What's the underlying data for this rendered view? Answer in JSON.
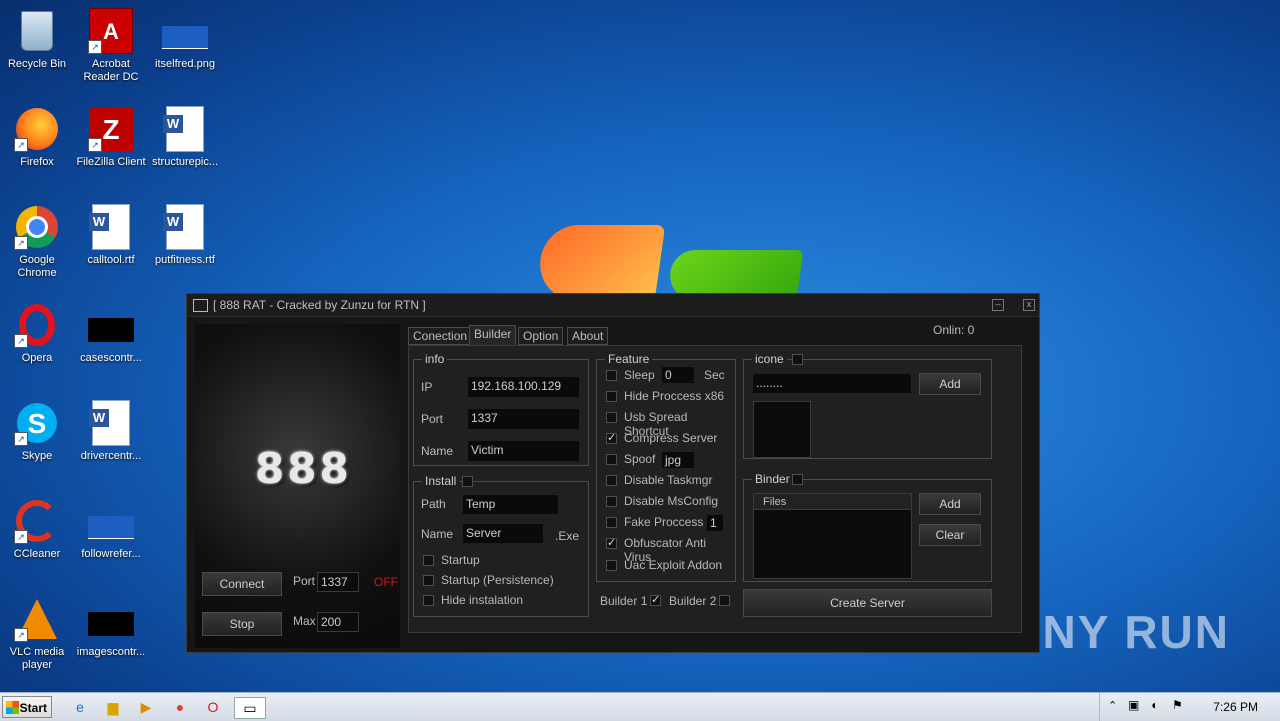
{
  "desktop": {
    "icons": [
      {
        "label": "Recycle Bin",
        "icon": "recycle-bin-icon"
      },
      {
        "label": "Acrobat Reader DC",
        "icon": "acrobat-icon"
      },
      {
        "label": "itselfred.png",
        "icon": "image-file-icon"
      },
      {
        "label": "Firefox",
        "icon": "firefox-icon"
      },
      {
        "label": "FileZilla Client",
        "icon": "filezilla-icon"
      },
      {
        "label": "structurepic...",
        "icon": "word-doc-icon"
      },
      {
        "label": "Google Chrome",
        "icon": "chrome-icon"
      },
      {
        "label": "calltool.rtf",
        "icon": "word-doc-icon"
      },
      {
        "label": "putfitness.rtf",
        "icon": "word-doc-icon"
      },
      {
        "label": "Opera",
        "icon": "opera-icon"
      },
      {
        "label": "casescontr...",
        "icon": "image-file-icon"
      },
      {
        "label": "Skype",
        "icon": "skype-icon"
      },
      {
        "label": "drivercentr...",
        "icon": "word-doc-icon"
      },
      {
        "label": "CCleaner",
        "icon": "ccleaner-icon"
      },
      {
        "label": "followrefer...",
        "icon": "image-file-icon"
      },
      {
        "label": "VLC media player",
        "icon": "vlc-icon"
      },
      {
        "label": "imagescontr...",
        "icon": "image-file-icon"
      }
    ],
    "watermark": "ANY RUN"
  },
  "window": {
    "title": "[  888 RAT - Cracked by Zunzu for RTN ]",
    "minimize": "‒",
    "close": "x",
    "logo": "888",
    "connect_label": "Connect",
    "stop_label": "Stop",
    "port_label": "Port",
    "port_value": "1337",
    "status": "OFF",
    "max_label": "Max",
    "max_value": "200",
    "online_label": "Onlin:  0",
    "tabs": [
      "Conection",
      "Builder",
      "Option",
      "About"
    ],
    "active_tab": "Builder",
    "info": {
      "title": "info",
      "ip_label": "IP",
      "ip_value": "192.168.100.129",
      "port_label": "Port",
      "port_value": "1337",
      "name_label": "Name",
      "name_value": "Victim"
    },
    "install": {
      "title": "Install",
      "path_label": "Path",
      "path_value": "Temp",
      "name_label": "Name",
      "name_value": "Server",
      "ext": ".Exe",
      "options": [
        "Startup",
        "Startup (Persistence)",
        "Hide instalation"
      ]
    },
    "feature": {
      "title": "Feature",
      "sleep_label": "Sleep",
      "sleep_value": "0",
      "sleep_unit": "Sec",
      "hide_process": "Hide Proccess x86",
      "usb_spread": "Usb Spread Shortcut",
      "compress": "Compress Server",
      "spoof_label": "Spoof",
      "spoof_value": "jpg",
      "disable_taskmgr": "Disable Taskmgr",
      "disable_msconfig": "Disable MsConfig",
      "fake_process": "Fake Proccess",
      "fake_process_value": "1",
      "obfuscator": "Obfuscator Anti Virus",
      "uac": "Uac Exploit Addon"
    },
    "builder1": "Builder 1",
    "builder2": "Builder 2",
    "icone": {
      "title": "icone",
      "path_value": "........",
      "add_label": "Add"
    },
    "binder": {
      "title": "Binder",
      "files_header": "Files",
      "add_label": "Add",
      "clear_label": "Clear"
    },
    "create_label": "Create Server"
  },
  "taskbar": {
    "start_label": "Start",
    "clock": "7:26 PM"
  }
}
